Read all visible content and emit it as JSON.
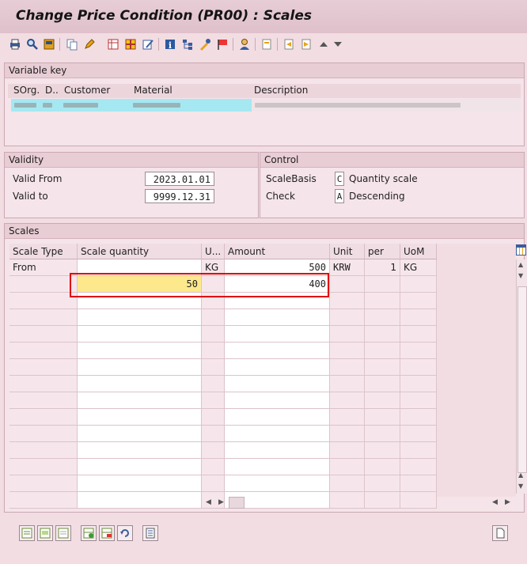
{
  "window": {
    "title": "Change Price Condition (PR00) : Scales"
  },
  "toolbar": {
    "icons": [
      "print-icon",
      "find-icon",
      "save-as-icon",
      "copy-icon",
      "edit-icon",
      "table-icon",
      "org-icon",
      "edit-text-icon",
      "info-icon",
      "hierarchy-icon",
      "tools-icon",
      "flag-icon",
      "user-icon",
      "document-icon",
      "first-page-icon",
      "next-page-icon",
      "scroll-up-icon",
      "scroll-down-icon"
    ]
  },
  "variable_key": {
    "header": "Variable key",
    "columns": [
      "SOrg.",
      "D..",
      "Customer",
      "Material",
      "Description"
    ]
  },
  "validity": {
    "header": "Validity",
    "valid_from_label": "Valid From",
    "valid_from_value": "2023.01.01",
    "valid_to_label": "Valid to",
    "valid_to_value": "9999.12.31"
  },
  "control": {
    "header": "Control",
    "scale_basis_label": "ScaleBasis",
    "scale_basis_key": "C",
    "scale_basis_text": "Quantity scale",
    "check_label": "Check",
    "check_key": "A",
    "check_text": "Descending"
  },
  "scales": {
    "header": "Scales",
    "columns": [
      "Scale Type",
      "Scale quantity",
      "U...",
      "Amount",
      "Unit",
      "per",
      "UoM"
    ],
    "rows": [
      {
        "scale_type": "From",
        "scale_quantity": "",
        "unit_qty": "KG",
        "amount": "500",
        "unit": "KRW",
        "per": "1",
        "uom": "KG"
      },
      {
        "scale_type": "",
        "scale_quantity": "50",
        "unit_qty": "",
        "amount": "400",
        "unit": "",
        "per": "",
        "uom": ""
      }
    ],
    "empty_rows": 13
  },
  "colors": {
    "background": "#f2dde3",
    "highlight_input": "#fde98c",
    "selection_border": "#e00000",
    "blurred_row": "#a6e8f2"
  }
}
